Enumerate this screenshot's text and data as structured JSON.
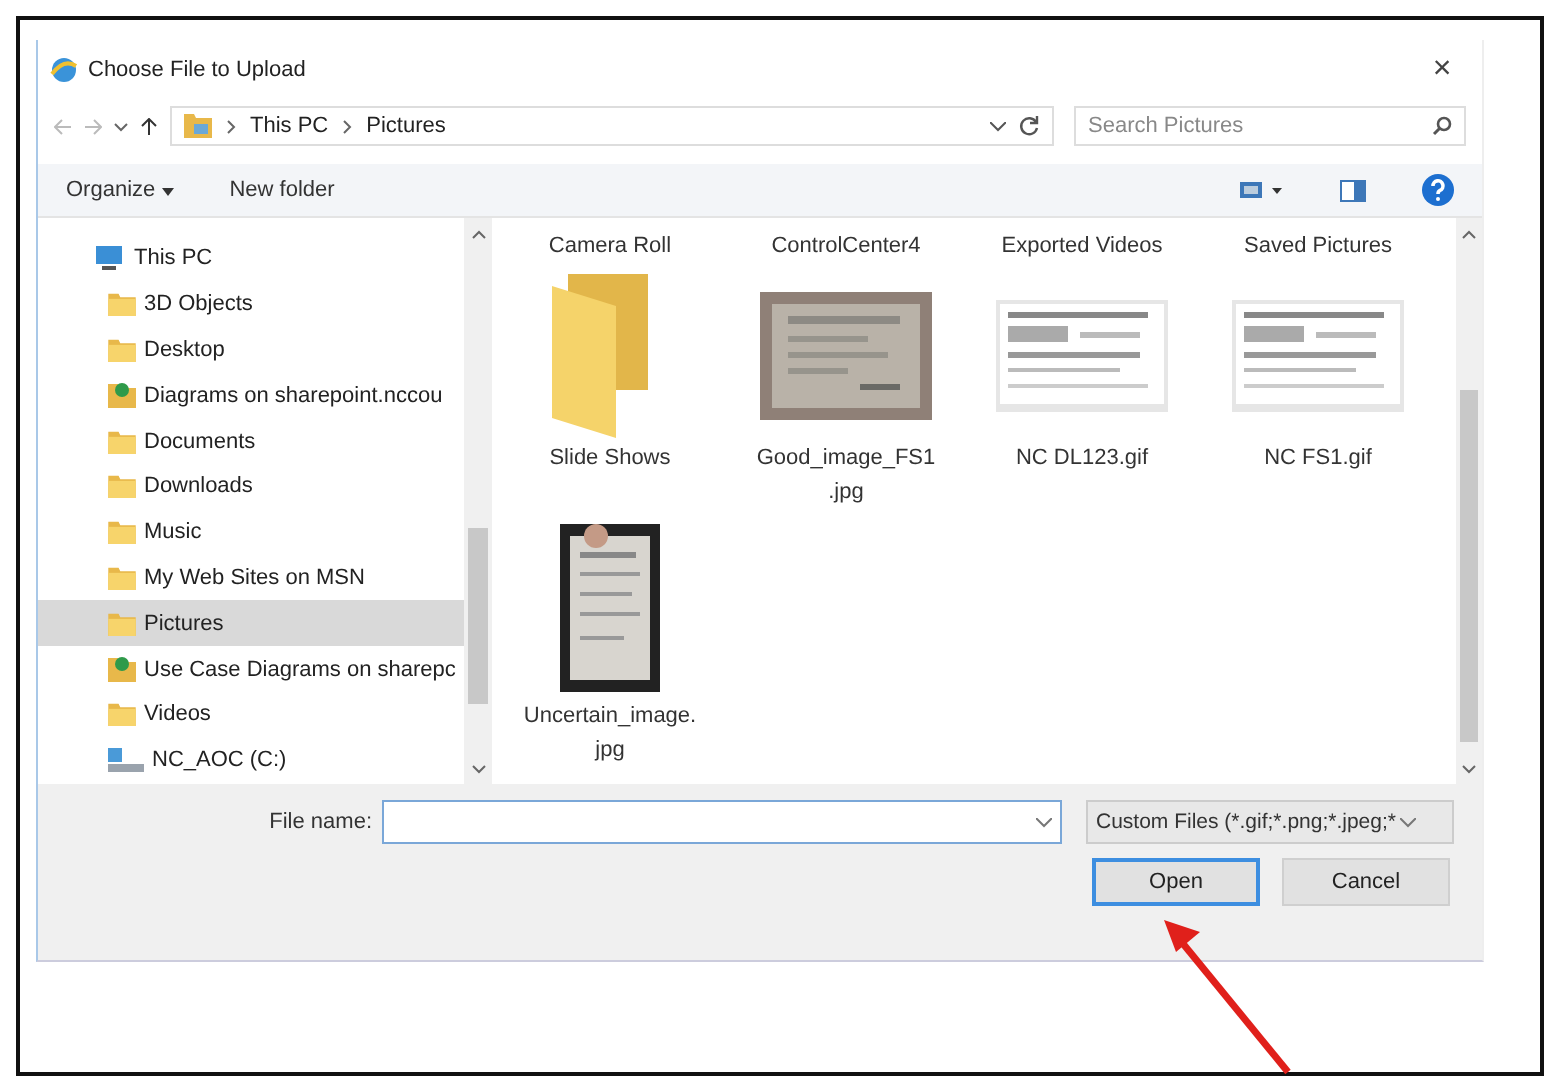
{
  "window": {
    "title": "Choose File to Upload",
    "close": "×"
  },
  "navigation": {
    "back_disabled": true,
    "forward_disabled": true,
    "breadcrumbs": [
      "This PC",
      "Pictures"
    ],
    "search": {
      "placeholder": "Search Pictures"
    }
  },
  "toolbar": {
    "buttons": [
      {
        "label": "Organize",
        "dropdown": true
      },
      {
        "label": "New folder",
        "dropdown": false
      }
    ]
  },
  "sidebar": {
    "items": [
      {
        "label": "This PC",
        "kind": "pc",
        "selected": false,
        "children": [
          {
            "label": "3D Objects",
            "kind": "folder",
            "selected": false
          },
          {
            "label": "Desktop",
            "kind": "folder",
            "selected": false
          },
          {
            "label": "Diagrams on sharepoint.nccou",
            "kind": "share",
            "selected": false
          },
          {
            "label": "Documents",
            "kind": "folder",
            "selected": false
          },
          {
            "label": "Downloads",
            "kind": "folder",
            "selected": false
          },
          {
            "label": "Music",
            "kind": "folder",
            "selected": false
          },
          {
            "label": "My Web Sites on MSN",
            "kind": "folder",
            "selected": false
          },
          {
            "label": "Pictures",
            "kind": "folder",
            "selected": true
          },
          {
            "label": "Use Case Diagrams on sharepc",
            "kind": "share",
            "selected": false
          },
          {
            "label": "Videos",
            "kind": "folder",
            "selected": false
          },
          {
            "label": "NC_AOC (C:)",
            "kind": "drive",
            "selected": false
          }
        ]
      }
    ]
  },
  "files": [
    {
      "label": "Camera Roll",
      "kind": "cut"
    },
    {
      "label": "ControlCenter4",
      "kind": "cut"
    },
    {
      "label": "Exported Videos",
      "kind": "cut"
    },
    {
      "label": "Saved Pictures",
      "kind": "cut"
    },
    {
      "label": "Slide Shows",
      "kind": "folder"
    },
    {
      "label": "Good_image_FS1\n.jpg"
    },
    {
      "label": "NC DL123.gif",
      "kind": "document"
    },
    {
      "label": "NC FS1.gif",
      "kind": "document"
    },
    {
      "label": "Uncertain_image.\njpg",
      "kind": "tall-photo"
    }
  ],
  "footer": {
    "file_name_label": "File name:",
    "file_type": "Custom Files (*.gif;*.png;*.jpeg;*",
    "buttons": [
      {
        "label": "Open",
        "default": true
      },
      {
        "label": "Cancel",
        "default": false
      }
    ]
  },
  "annotation": {
    "kind": "arrow"
  }
}
